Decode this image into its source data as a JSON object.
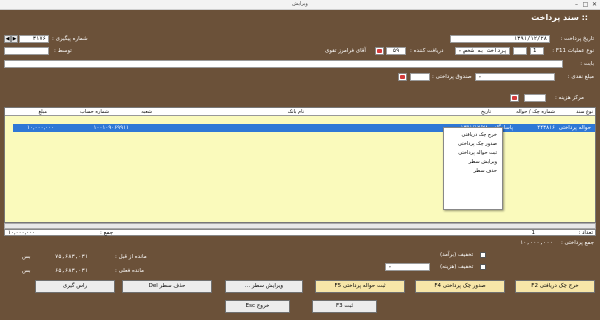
{
  "window": {
    "title": "ویرایش",
    "header_title": ":: سند پرداخت"
  },
  "form": {
    "date_label": "تاریخ پرداخت :",
    "date_value": "۱۳۹۱/۱۲/۲۸",
    "followup_label": "شماره پیگیری :",
    "followup_value": "۳۱۷۶",
    "operation_label": "نوع عملیات F11 :",
    "operation_code": "1",
    "operation_type": "پرداخت به شخص",
    "receiver_label": "دریافت کننده :",
    "receiver_code": "۵۹",
    "receiver_name": "آقای فرامرز  تقوی",
    "by_label": "توسط :",
    "desc_label": "بابت :",
    "cash_amount_label": "مبلغ نقدی :",
    "fund_label": "صندوق پرداختی :",
    "cost_center_label": "مرکز هزینه :"
  },
  "grid": {
    "columns": [
      "نوع سند",
      "شماره چک / حواله",
      "تاریخ",
      "نام بانک",
      "شعبه",
      "شماره حساب",
      "مبلغ"
    ],
    "rows": [
      {
        "type": "حواله پرداختی",
        "number": "۴۴۳۸۱۶",
        "date": "۱۳۹۱/۱۲/۲۸",
        "bank": "پاسارگاد",
        "branch": "",
        "account": "۱۰۰۱۰۹۰۶۹۹۱۱",
        "amount": "۱۰,۰۰۰,۰۰۰"
      }
    ],
    "context_menu": [
      "خرج چک دریافتی",
      "صدور چک پرداختی",
      "ثبت حواله پرداختی",
      "ویرایش سطر",
      "حذف سطر"
    ],
    "count_label": "تعداد :",
    "count_value": "1",
    "sum_label": "جمع :",
    "sum_value": "۱۰,۰۰۰,۰۰۰"
  },
  "summary": {
    "total_label": "جمع پرداختی :",
    "total_value": "۱۰,۰۰۰,۰۰۰",
    "prev_balance_label": "مانده از قبل :",
    "prev_balance_value": "۷۵,۶۸۳,۰۳۱",
    "prev_balance_side": "بس",
    "final_balance_label": "مانده فعلی :",
    "final_balance_value": "۶۵,۶۸۳,۰۳۱",
    "final_balance_side": "بس",
    "discount_plus": "تخفیف (برآمد)",
    "discount_minus": "تخفیف (هزینه)"
  },
  "buttons": {
    "cheque_spend": "خرج چک دریافتی F2",
    "cheque_issue": "صدور چک پرداختی F4",
    "transfer": "ثبت حواله پرداختی F5",
    "edit_row": "ویرایش سطر ...",
    "delete_row": "حذف سطر Del",
    "split": "راس گیری",
    "save": "ثبت F3",
    "exit": "خروج Esc"
  },
  "colors": {
    "background": "#6b5139",
    "grid": "#fafabc",
    "selection": "#2f78d6"
  }
}
